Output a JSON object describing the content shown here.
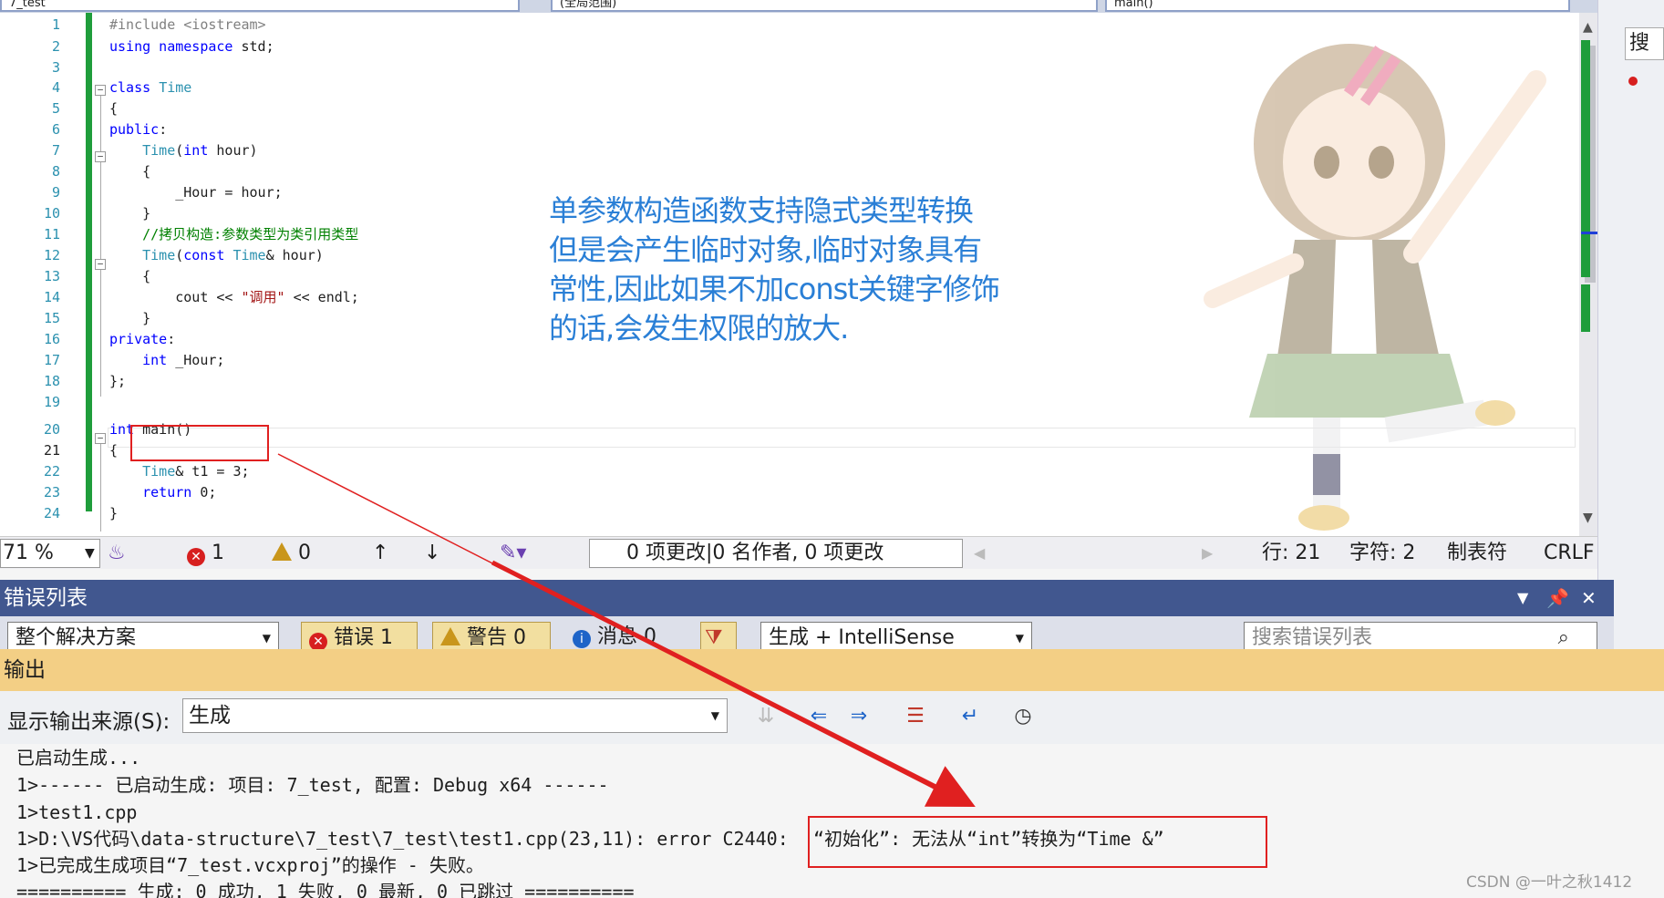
{
  "top": {
    "file_tab": "7_test",
    "scope": "(全局范围)",
    "function": "main()"
  },
  "editor": {
    "line_numbers": [
      "1",
      "2",
      "3",
      "4",
      "5",
      "6",
      "7",
      "8",
      "9",
      "10",
      "11",
      "12",
      "13",
      "14",
      "15",
      "16",
      "17",
      "18",
      "19",
      "20",
      "21",
      "22",
      "23",
      "24"
    ],
    "annotation": [
      "单参数构造函数支持隐式类型转换",
      "但是会产生临时对象,临时对象具有",
      "常性,因此如果不加const关键字修饰",
      "的话,会发生权限的放大."
    ]
  },
  "status": {
    "zoom": "71 %",
    "errors": "1",
    "warnings": "0",
    "git": "0 项更改|0 名作者, 0 项更改",
    "row": "行: 21",
    "col": "字符: 2",
    "tab": "制表符",
    "eol": "CRLF"
  },
  "error_list": {
    "title": "错误列表",
    "scope_select": "整个解决方案",
    "errors_btn": "错误 1",
    "warnings_btn": "警告 0",
    "messages_btn": "消息 0",
    "build_select": "生成 + IntelliSense",
    "search_placeholder": "搜索错误列表"
  },
  "output": {
    "title": "输出",
    "source_label": "显示输出来源(S):",
    "source_value": "生成",
    "lines": [
      "已启动生成...",
      "1>------ 已启动生成: 项目: 7_test, 配置: Debug x64 ------",
      "1>test1.cpp",
      "1>D:\\VS代码\\data-structure\\7_test\\7_test\\test1.cpp(23,11): error C2440:",
      "1>已完成生成项目“7_test.vcxproj”的操作 - 失败。",
      "========== 生成: 0 成功, 1 失败, 0 最新, 0 已跳过 =========="
    ],
    "error_message": "“初始化”: 无法从“int”转换为“Time &”"
  },
  "right_strip": {
    "search_fragment": "搜"
  },
  "watermark": "CSDN @一叶之秋1412",
  "colors": {
    "keyword": "#0000ff",
    "type": "#2b91af",
    "string": "#a31515",
    "comment": "#008000",
    "annotation": "#2a7fd6",
    "error_header": "#41578f",
    "output_header": "#f3cf85",
    "highlight_red": "#e02020"
  }
}
